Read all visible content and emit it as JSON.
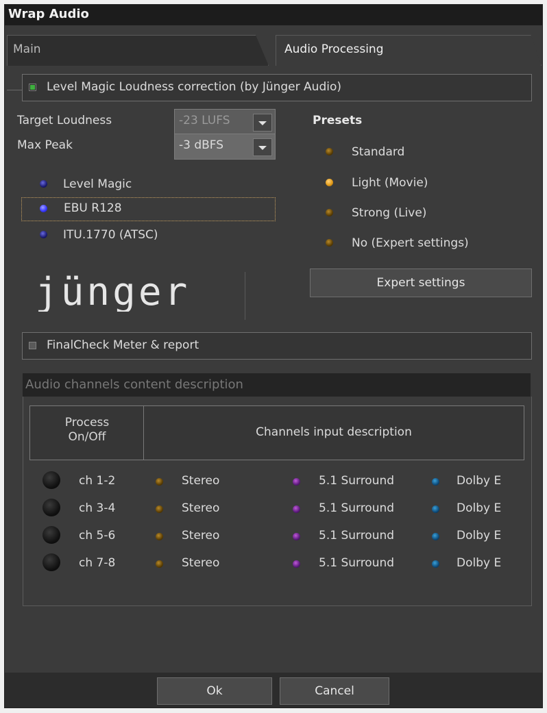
{
  "window": {
    "title": "Wrap Audio"
  },
  "tabs": [
    {
      "label": "Main"
    },
    {
      "label": "Audio Processing"
    }
  ],
  "level_magic": {
    "checkbox_label": "Level Magic Loudness correction (by Jünger Audio)",
    "checked": true,
    "target_loudness": {
      "label": "Target Loudness",
      "value": "-23 LUFS"
    },
    "max_peak": {
      "label": "Max Peak",
      "value": "-3 dBFS"
    },
    "modes": [
      {
        "label": "Level Magic",
        "state": "off"
      },
      {
        "label": "EBU R128",
        "state": "selected"
      },
      {
        "label": "ITU.1770 (ATSC)",
        "state": "off"
      }
    ],
    "presets": {
      "title": "Presets",
      "items": [
        {
          "label": "Standard",
          "state": "off"
        },
        {
          "label": "Light (Movie)",
          "state": "selected"
        },
        {
          "label": "Strong (Live)",
          "state": "off"
        },
        {
          "label": "No (Expert settings)",
          "state": "off"
        }
      ]
    },
    "expert_button": "Expert settings",
    "logo_text": "jünger"
  },
  "final_check": {
    "checkbox_label": "FinalCheck Meter & report",
    "checked": false
  },
  "channels_section": {
    "title": "Audio channels content description",
    "header": {
      "process": "Process On/Off",
      "description": "Channels input description"
    },
    "rows": [
      {
        "name": "ch 1-2",
        "opts": [
          "Stereo",
          "5.1 Surround",
          "Dolby E"
        ]
      },
      {
        "name": "ch 3-4",
        "opts": [
          "Stereo",
          "5.1 Surround",
          "Dolby E"
        ]
      },
      {
        "name": "ch 5-6",
        "opts": [
          "Stereo",
          "5.1 Surround",
          "Dolby E"
        ]
      },
      {
        "name": "ch 7-8",
        "opts": [
          "Stereo",
          "5.1 Surround",
          "Dolby E"
        ]
      }
    ]
  },
  "footer": {
    "ok": "Ok",
    "cancel": "Cancel"
  },
  "colors": {
    "background": "#3b3b3b",
    "titlebar": "#1c1c1c",
    "led_blue": "#3a3aff",
    "led_amber": "#e39c1a",
    "led_purple": "#5a1a7a",
    "led_cyan": "#0e4a78",
    "check_on": "#3fae3f"
  }
}
